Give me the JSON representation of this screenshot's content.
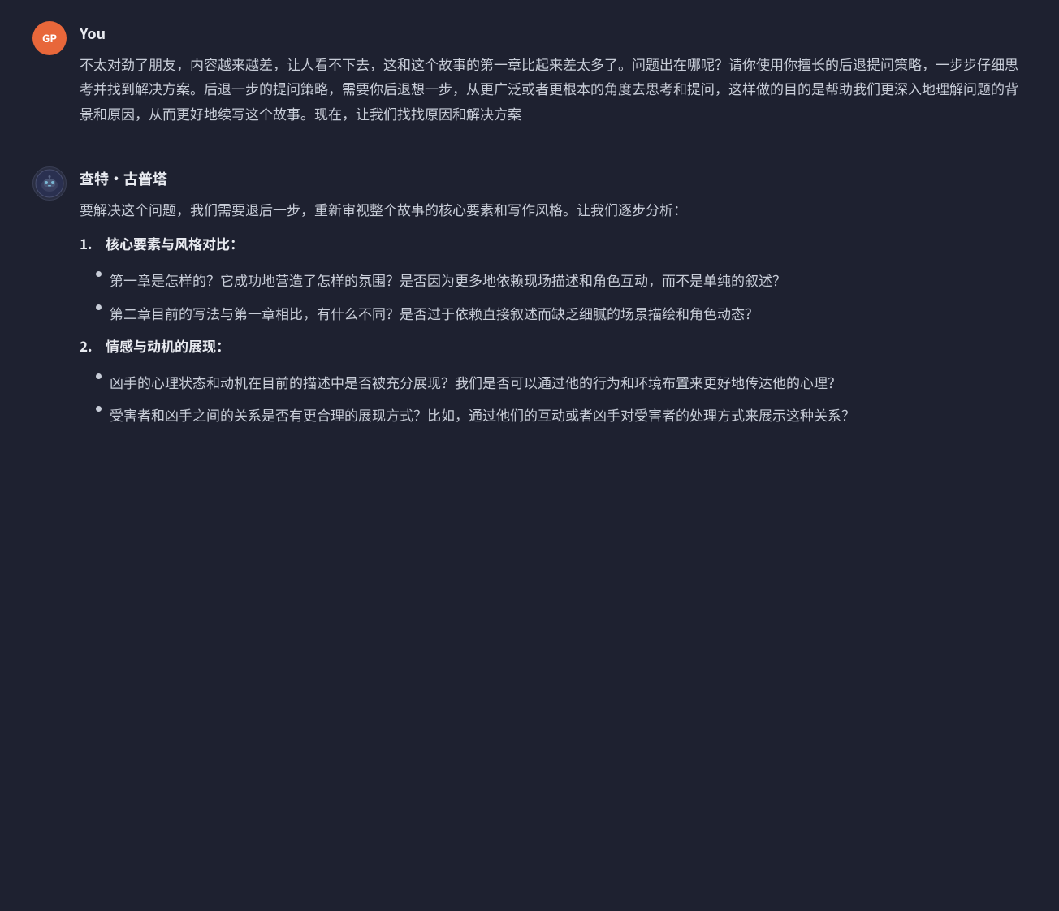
{
  "colors": {
    "background": "#1e2130",
    "text_primary": "#c8cdd8",
    "text_heading": "#e8eaf0",
    "avatar_user_bg": "#e8673a",
    "avatar_ai_bg": "#2a2e42"
  },
  "user_message": {
    "sender": "You",
    "avatar_initials": "GP",
    "text": "不太对劲了朋友，内容越来越差，让人看不下去，这和这个故事的第一章比起来差太多了。问题出在哪呢？请你使用你擅长的后退提问策略，一步步仔细思考并找到解决方案。后退一步的提问策略，需要你后退想一步，从更广泛或者更根本的角度去思考和提问，这样做的目的是帮助我们更深入地理解问题的背景和原因，从而更好地续写这个故事。现在，让我们找找原因和解决方案"
  },
  "ai_message": {
    "sender": "查特·古普塔",
    "intro": "要解决这个问题，我们需要退后一步，重新审视整个故事的核心要素和写作风格。让我们逐步分析：",
    "sections": [
      {
        "number": "1.",
        "title": "核心要素与风格对比",
        "colon": "：",
        "bullets": [
          "第一章是怎样的？它成功地营造了怎样的氛围？是否因为更多地依赖现场描述和角色互动，而不是单纯的叙述？",
          "第二章目前的写法与第一章相比，有什么不同？是否过于依赖直接叙述而缺乏细腻的场景描绘和角色动态？"
        ]
      },
      {
        "number": "2.",
        "title": "情感与动机的展现",
        "colon": "：",
        "bullets": [
          "凶手的心理状态和动机在目前的描述中是否被充分展现？我们是否可以通过他的行为和环境布置来更好地传达他的心理？",
          "受害者和凶手之间的关系是否有更合理的展现方式？比如，通过他们的互动或者凶手对受害者的处理方式来展示这种关系？"
        ]
      }
    ]
  }
}
